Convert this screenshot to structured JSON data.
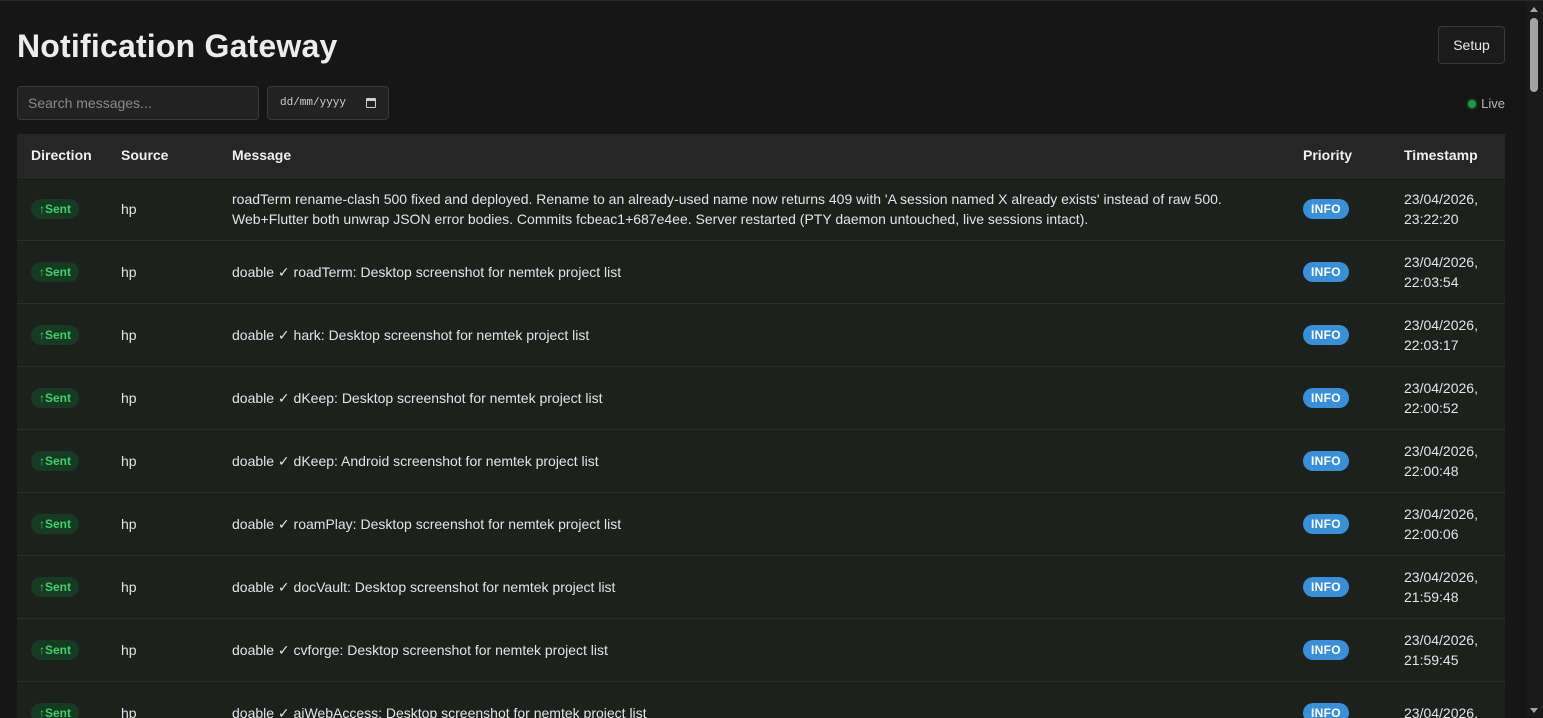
{
  "header": {
    "title": "Notification Gateway",
    "setup_label": "Setup"
  },
  "filters": {
    "search_placeholder": "Search messages...",
    "date_placeholder": "dd/mm/yyyy"
  },
  "status": {
    "live_label": "Live",
    "live_color": "#1f9a4a"
  },
  "table": {
    "columns": [
      "Direction",
      "Source",
      "Message",
      "Priority",
      "Timestamp"
    ],
    "rows": [
      {
        "direction": "↑Sent",
        "source": "hp",
        "message": "roadTerm rename-clash 500 fixed and deployed. Rename to an already-used name now returns 409 with 'A session named X already exists' instead of raw 500. Web+Flutter both unwrap JSON error bodies. Commits fcbeac1+687e4ee. Server restarted (PTY daemon untouched, live sessions intact).",
        "priority": "INFO",
        "date": "23/04/2026,",
        "time": "23:22:20"
      },
      {
        "direction": "↑Sent",
        "source": "hp",
        "message": "doable ✓ roadTerm: Desktop screenshot for nemtek project list",
        "priority": "INFO",
        "date": "23/04/2026,",
        "time": "22:03:54"
      },
      {
        "direction": "↑Sent",
        "source": "hp",
        "message": "doable ✓ hark: Desktop screenshot for nemtek project list",
        "priority": "INFO",
        "date": "23/04/2026,",
        "time": "22:03:17"
      },
      {
        "direction": "↑Sent",
        "source": "hp",
        "message": "doable ✓ dKeep: Desktop screenshot for nemtek project list",
        "priority": "INFO",
        "date": "23/04/2026,",
        "time": "22:00:52"
      },
      {
        "direction": "↑Sent",
        "source": "hp",
        "message": "doable ✓ dKeep: Android screenshot for nemtek project list",
        "priority": "INFO",
        "date": "23/04/2026,",
        "time": "22:00:48"
      },
      {
        "direction": "↑Sent",
        "source": "hp",
        "message": "doable ✓ roamPlay: Desktop screenshot for nemtek project list",
        "priority": "INFO",
        "date": "23/04/2026,",
        "time": "22:00:06"
      },
      {
        "direction": "↑Sent",
        "source": "hp",
        "message": "doable ✓ docVault: Desktop screenshot for nemtek project list",
        "priority": "INFO",
        "date": "23/04/2026,",
        "time": "21:59:48"
      },
      {
        "direction": "↑Sent",
        "source": "hp",
        "message": "doable ✓ cvforge: Desktop screenshot for nemtek project list",
        "priority": "INFO",
        "date": "23/04/2026,",
        "time": "21:59:45"
      },
      {
        "direction": "↑Sent",
        "source": "hp",
        "message": "doable ✓ aiWebAccess: Desktop screenshot for nemtek project list",
        "priority": "INFO",
        "date": "23/04/2026,",
        "time": ""
      }
    ]
  },
  "colors": {
    "sent_badge_text": "#3fcf6b",
    "sent_badge_bg": "#163a22",
    "info_badge_bg": "#3b8fd6"
  }
}
